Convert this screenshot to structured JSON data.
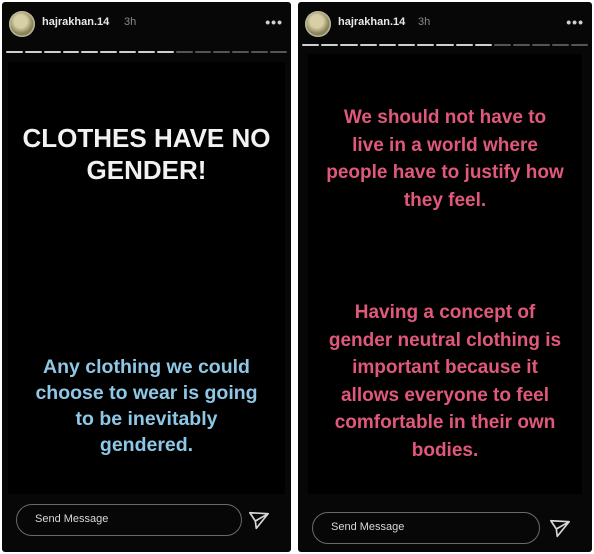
{
  "left_story": {
    "username": "hajrakhan.14",
    "time": "3h",
    "more": "•••",
    "headline": "CLOTHES HAVE NO GENDER!",
    "caption": "Any clothing we could choose to wear is going to be inevitably gendered.",
    "reply_placeholder": "Send Message"
  },
  "right_story": {
    "username": "hajrakhan.14",
    "time": "3h",
    "more": "•••",
    "paragraph1": "We should not have to live in a world where people have to justify how they feel.",
    "paragraph2": "Having a concept of gender neutral clothing is important because it allows everyone to feel comfortable in their own bodies.",
    "reply_placeholder": "Send Message"
  },
  "colors": {
    "headline": "#f2f2f2",
    "caption_blue": "#8fc7e6",
    "pink_text": "#e0587a",
    "background": "#070707"
  },
  "icons": {
    "avatar": "avatar",
    "more": "more-options-icon",
    "send": "paper-plane-icon"
  }
}
